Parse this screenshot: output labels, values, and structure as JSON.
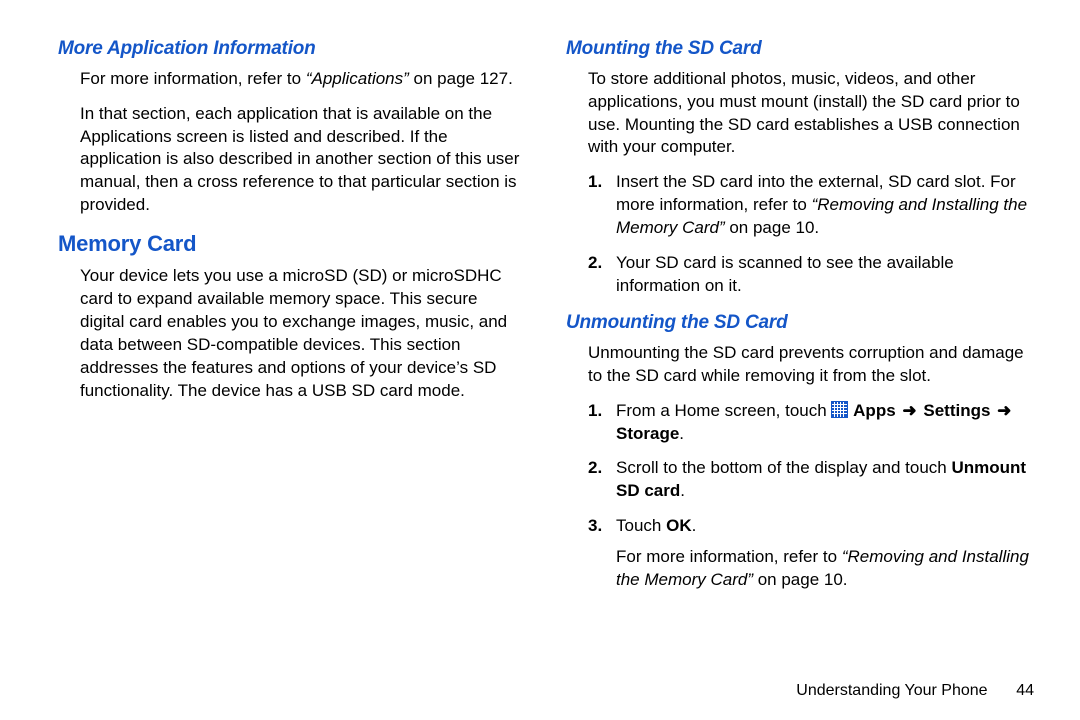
{
  "left": {
    "h_more_app": "More Application Information",
    "p1_a": "For more information, refer to ",
    "p1_ital": "“Applications”",
    "p1_b": " on page 127.",
    "p2": "In that section, each application that is available on the Applications screen is listed and described. If the application is also described in another section of this user manual, then a cross reference to that particular section is provided.",
    "h_memory": "Memory Card",
    "p3": "Your device lets you use a microSD (SD) or microSDHC card to expand available memory space. This secure digital card enables you to exchange images, music, and data between SD-compatible devices. This section addresses the features and options of your device’s SD functionality. The device has a USB SD card mode."
  },
  "right": {
    "h_mount": "Mounting the SD Card",
    "p1": "To store additional photos, music, videos, and other applications, you must mount (install) the SD card prior to use. Mounting the SD card establishes a USB connection with your computer.",
    "mount_steps": [
      {
        "n": "1.",
        "a": "Insert the SD card into the external, SD card slot. For more information, refer to ",
        "ital": "“Removing and Installing the Memory Card”",
        "b": " on page 10."
      },
      {
        "n": "2.",
        "a": "Your SD card is scanned to see the available information on it."
      }
    ],
    "h_unmount": "Unmounting the SD Card",
    "p2": "Unmounting the SD card prevents corruption and damage to the SD card while removing it from the slot.",
    "unmount_steps": {
      "s1": {
        "n": "1.",
        "a": "From a Home screen, touch ",
        "apps": "Apps",
        "settings": "Settings",
        "storage": "Storage"
      },
      "s2": {
        "n": "2.",
        "a": "Scroll to the bottom of the display and touch ",
        "b1": "Unmount SD card",
        "c": "."
      },
      "s3": {
        "n": "3.",
        "a": "Touch ",
        "b1": "OK",
        "c": "."
      }
    },
    "ref_a": "For more information, refer to ",
    "ref_ital": "“Removing and Installing the Memory Card”",
    "ref_b": " on page 10."
  },
  "footer": {
    "section": "Understanding Your Phone",
    "page": "44"
  },
  "glyphs": {
    "arrow": "➜"
  }
}
